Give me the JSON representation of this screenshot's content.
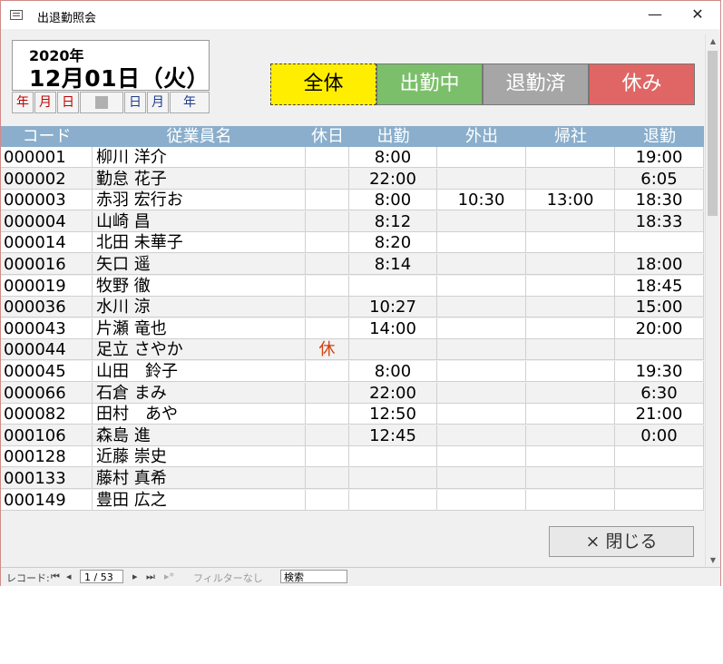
{
  "window": {
    "title": "出退勤照会",
    "minimize": "—",
    "close": "✕"
  },
  "date_panel": {
    "year": "2020年",
    "date": "12月01日（火）"
  },
  "nav_buttons": [
    "年",
    "月",
    "日",
    "",
    "日",
    "月",
    "年"
  ],
  "filters": {
    "all": "全体",
    "working": "出勤中",
    "left": "退勤済",
    "off": "休み"
  },
  "colors": {
    "header": "#8aaecb",
    "all": "#ffee00",
    "working": "#7bbf6a",
    "left": "#a6a6a6",
    "off": "#e06666"
  },
  "table": {
    "headers": [
      "コード",
      "従業員名",
      "休日",
      "出勤",
      "外出",
      "帰社",
      "退勤"
    ],
    "rows": [
      {
        "code": "000001",
        "name": "柳川 洋介",
        "holiday": "",
        "in": "8:00",
        "out": "",
        "back": "",
        "leave": "19:00"
      },
      {
        "code": "000002",
        "name": "勤怠 花子",
        "holiday": "",
        "in": "22:00",
        "out": "",
        "back": "",
        "leave": "6:05"
      },
      {
        "code": "000003",
        "name": "赤羽 宏行お",
        "holiday": "",
        "in": "8:00",
        "out": "10:30",
        "back": "13:00",
        "leave": "18:30"
      },
      {
        "code": "000004",
        "name": "山崎 昌",
        "holiday": "",
        "in": "8:12",
        "out": "",
        "back": "",
        "leave": "18:33"
      },
      {
        "code": "000014",
        "name": "北田 未華子",
        "holiday": "",
        "in": "8:20",
        "out": "",
        "back": "",
        "leave": ""
      },
      {
        "code": "000016",
        "name": "矢口 遥",
        "holiday": "",
        "in": "8:14",
        "out": "",
        "back": "",
        "leave": "18:00"
      },
      {
        "code": "000019",
        "name": "牧野 徹",
        "holiday": "",
        "in": "",
        "out": "",
        "back": "",
        "leave": "18:45"
      },
      {
        "code": "000036",
        "name": "水川 涼",
        "holiday": "",
        "in": "10:27",
        "out": "",
        "back": "",
        "leave": "15:00"
      },
      {
        "code": "000043",
        "name": "片瀬 竜也",
        "holiday": "",
        "in": "14:00",
        "out": "",
        "back": "",
        "leave": "20:00"
      },
      {
        "code": "000044",
        "name": "足立 さやか",
        "holiday": "休",
        "in": "",
        "out": "",
        "back": "",
        "leave": ""
      },
      {
        "code": "000045",
        "name": "山田　鈴子",
        "holiday": "",
        "in": "8:00",
        "out": "",
        "back": "",
        "leave": "19:30"
      },
      {
        "code": "000066",
        "name": "石倉 まみ",
        "holiday": "",
        "in": "22:00",
        "out": "",
        "back": "",
        "leave": "6:30"
      },
      {
        "code": "000082",
        "name": "田村　あや",
        "holiday": "",
        "in": "12:50",
        "out": "",
        "back": "",
        "leave": "21:00"
      },
      {
        "code": "000106",
        "name": "森島 進",
        "holiday": "",
        "in": "12:45",
        "out": "",
        "back": "",
        "leave": "0:00"
      },
      {
        "code": "000128",
        "name": "近藤 崇史",
        "holiday": "",
        "in": "",
        "out": "",
        "back": "",
        "leave": ""
      },
      {
        "code": "000133",
        "name": "藤村 真希",
        "holiday": "",
        "in": "",
        "out": "",
        "back": "",
        "leave": ""
      },
      {
        "code": "000149",
        "name": "豊田 広之",
        "holiday": "",
        "in": "",
        "out": "",
        "back": "",
        "leave": ""
      }
    ]
  },
  "close_button": "× 閉じる",
  "statusbar": {
    "record_label": "レコード:",
    "nav_first": "⏮",
    "nav_prev": "◂",
    "record_value": "1 / 53",
    "nav_next": "▸",
    "nav_last": "⏭",
    "nav_new": "▸*",
    "filter": "フィルターなし",
    "search": "検索"
  }
}
